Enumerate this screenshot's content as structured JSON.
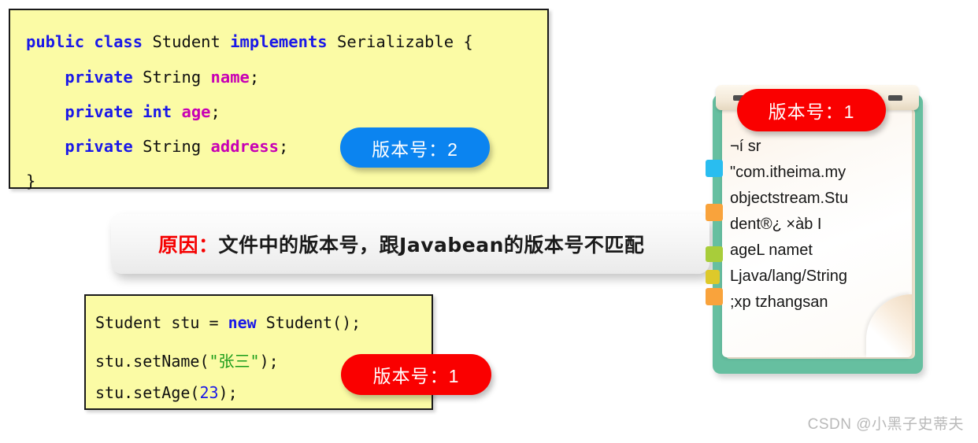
{
  "slide": {
    "background_color": "#ffffff"
  },
  "top_code_block": {
    "name": "Student javabean source",
    "background_color": "#fbfba5",
    "border_color": "#1a1a1a",
    "lines": [
      {
        "tokens": [
          {
            "t": "public",
            "c": "kw"
          },
          {
            "t": " ",
            "c": "plain"
          },
          {
            "t": "class",
            "c": "kw"
          },
          {
            "t": " Student ",
            "c": "plain"
          },
          {
            "t": "implements",
            "c": "kw"
          },
          {
            "t": " Serializable {",
            "c": "plain"
          }
        ]
      },
      {
        "tokens": [
          {
            "t": "    ",
            "c": "plain"
          },
          {
            "t": "private",
            "c": "kw"
          },
          {
            "t": " String ",
            "c": "plain"
          },
          {
            "t": "name",
            "c": "fld"
          },
          {
            "t": ";",
            "c": "plain"
          }
        ]
      },
      {
        "tokens": [
          {
            "t": "    ",
            "c": "plain"
          },
          {
            "t": "private",
            "c": "kw"
          },
          {
            "t": " ",
            "c": "plain"
          },
          {
            "t": "int",
            "c": "kw"
          },
          {
            "t": " ",
            "c": "plain"
          },
          {
            "t": "age",
            "c": "fld"
          },
          {
            "t": ";",
            "c": "plain"
          }
        ]
      },
      {
        "tokens": [
          {
            "t": "    ",
            "c": "plain"
          },
          {
            "t": "private",
            "c": "kw"
          },
          {
            "t": " String ",
            "c": "plain"
          },
          {
            "t": "address",
            "c": "fld"
          },
          {
            "t": ";",
            "c": "plain"
          }
        ]
      },
      {
        "tokens": [
          {
            "t": "}",
            "c": "plain"
          }
        ]
      }
    ]
  },
  "bottom_code_block": {
    "name": "Student usage snippet",
    "background_color": "#fbfba5",
    "border_color": "#1a1a1a",
    "lines": [
      {
        "tokens": [
          {
            "t": "Student stu = ",
            "c": "plain"
          },
          {
            "t": "new",
            "c": "kw"
          },
          {
            "t": " Student();",
            "c": "plain"
          }
        ]
      },
      {
        "tokens": [
          {
            "t": "stu.setName(",
            "c": "plain"
          },
          {
            "t": "\"张三\"",
            "c": "str"
          },
          {
            "t": ");",
            "c": "plain"
          }
        ]
      },
      {
        "tokens": [
          {
            "t": "stu.setAge(",
            "c": "plain"
          },
          {
            "t": "23",
            "c": "num"
          },
          {
            "t": ");",
            "c": "plain"
          }
        ]
      }
    ]
  },
  "badges": {
    "javabean_version": {
      "label": "版本号：2",
      "color": "#0b84f0"
    },
    "code_version": {
      "label": "版本号：1",
      "color": "#fa0000"
    },
    "file_version": {
      "label": "版本号：1",
      "color": "#fa0000"
    }
  },
  "reason_banner": {
    "prefix": "原因：",
    "prefix_color": "#f50000",
    "text": "文件中的版本号，跟Javabean的版本号不匹配"
  },
  "notepad": {
    "frame_color": "#66bfa0",
    "paper_color": "#fffdfa",
    "content": "¬í sr\n\"com.itheima.my\nobjectstream.Stu\ndent®¿ ×àb I\nageL namet\nLjava/lang/String\n;xp  tzhangsan",
    "tabs": [
      {
        "color": "#29bdf0"
      },
      {
        "color": "#f9a33c"
      },
      {
        "color": "#a8cd3a"
      },
      {
        "color": "#ddc92a"
      },
      {
        "color": "#f9a33c"
      }
    ]
  },
  "watermark": {
    "text": "CSDN @小黑子史蒂夫"
  }
}
